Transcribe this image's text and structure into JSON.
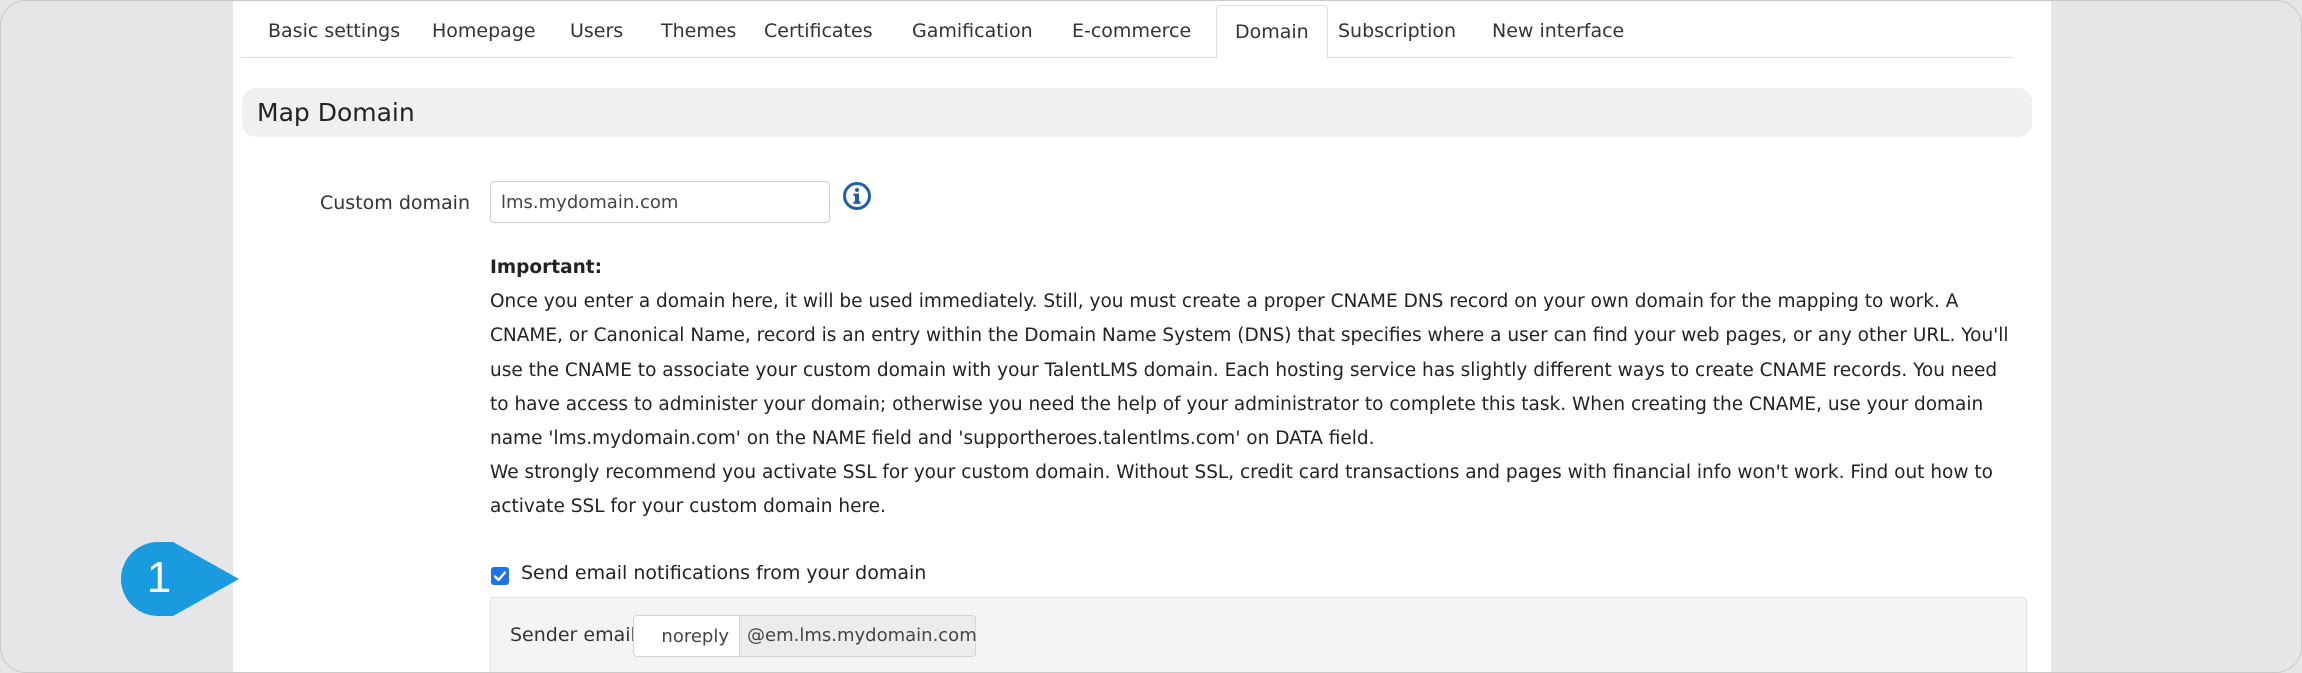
{
  "tabs": [
    {
      "label": "Basic settings"
    },
    {
      "label": "Homepage"
    },
    {
      "label": "Users"
    },
    {
      "label": "Themes"
    },
    {
      "label": "Certificates"
    },
    {
      "label": "Gamification"
    },
    {
      "label": "E-commerce"
    },
    {
      "label": "Domain",
      "active": true
    },
    {
      "label": "Subscription"
    },
    {
      "label": "New interface"
    }
  ],
  "section": {
    "title": "Map Domain"
  },
  "custom_domain": {
    "label": "Custom domain",
    "value": "lms.mydomain.com",
    "info_icon": "info-circle-icon"
  },
  "important": {
    "heading": "Important:",
    "paragraph1": "Once you enter a domain here, it will be used immediately. Still, you must create a proper CNAME DNS record on your own domain for the mapping to work. A CNAME, or Canonical Name, record is an entry within the Domain Name System (DNS) that specifies where a user can find your web pages, or any other URL. You'll use the CNAME to associate your custom domain with your TalentLMS domain. Each hosting service has slightly different ways to create CNAME records. You need to have access to administer your domain; otherwise you need the help of your administrator to complete this task. When creating the CNAME, use your domain name 'lms.mydomain.com' on the NAME field and 'supportheroes.talentlms.com' on DATA field.",
    "paragraph2": "We strongly recommend you activate SSL for your custom domain. Without SSL, credit card transactions and pages with financial info won't work. Find out how to activate SSL for your custom domain here."
  },
  "callout": {
    "number": "1",
    "color": "#1a9be0"
  },
  "notifications": {
    "checkbox_label": "Send email notifications from your domain",
    "checked": true
  },
  "sender": {
    "label": "Sender email",
    "value": "noreply",
    "suffix": "@em.lms.mydomain.com"
  },
  "colors": {
    "accent": "#1a73e8",
    "info_icon": "#1f5fa8",
    "callout": "#1a9be0"
  }
}
